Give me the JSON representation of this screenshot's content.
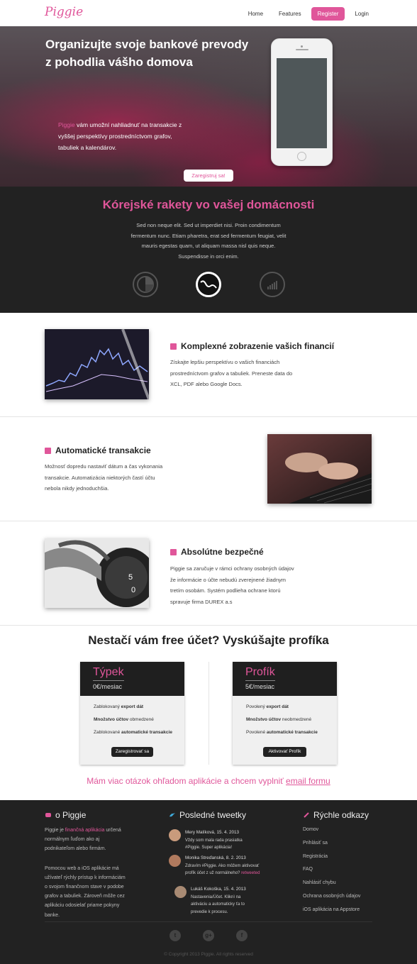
{
  "header": {
    "logo": "Piggie",
    "nav": [
      {
        "label": "Home"
      },
      {
        "label": "Features"
      },
      {
        "label": "Register"
      },
      {
        "label": "Login"
      }
    ]
  },
  "hero": {
    "title_line1": "Organizujte svoje bankové prevody",
    "title_line2": "z pohodlia vášho domova",
    "text_brand": "Piggie",
    "text_rest": " vám umožní nahliadnuť na transakcie z vyššej perspektívy prostredníctvom grafov, tabuliek a kalendárov.",
    "cta": "Zaregistruj sa!"
  },
  "promo": {
    "title": "Kórejské rakety vo vašej domácnosti",
    "text": "Sed non neque elit. Sed ut imperdiet nisi. Proin condimentum fermentum nunc. Etiam pharetra, erat sed fermentum feugiat, velit mauris egestas quam, ut aliquam massa nisl quis neque. Suspendisse in orci enim."
  },
  "features": [
    {
      "title": "Komplexné zobrazenie vašich financií",
      "text": "Získajte lepšiu perspektívu o vašich financiách prostredníctvom grafov a tabuliek. Preneste data do XCL, PDF alebo Google Docs."
    },
    {
      "title": "Automatické transakcie",
      "text": "Možnosť dopredu nastaviť dátum a čas vykonania transakcie. Automatizácia niektorých častí účtu nebola nikdy jednoduchšia."
    },
    {
      "title": "Absolútne bezpečné",
      "text": "Piggie sa zaručuje v rámci ochrany osobných údajov že informácie o účte nebudú zverejnené žiadnym tretím osobám. Systém podlieha ochrane ktorú spravuje firma DUREX a.s"
    }
  ],
  "pricing": {
    "title": "Nestačí vám free účet? Vyskúšajte profíka",
    "plans": [
      {
        "name": "Týpek",
        "price": "0€/mesiac",
        "rows": [
          {
            "pre": "Zablokovaný ",
            "strong": "export dát",
            "post": ""
          },
          {
            "pre": "",
            "strong": "Množstvo účtov",
            "post": " obmedzené"
          },
          {
            "pre": "Zablokované ",
            "strong": "automatické transakcie",
            "post": ""
          }
        ],
        "button": "Zaregistrovať sa"
      },
      {
        "name": "Profík",
        "price": "5€/mesiac",
        "rows": [
          {
            "pre": "Povolený ",
            "strong": "export dát",
            "post": ""
          },
          {
            "pre": "",
            "strong": "Množstvo účtov",
            "post": " neobmedzené"
          },
          {
            "pre": "Povolené ",
            "strong": "automatické transakcie",
            "post": ""
          }
        ],
        "button": "Aktivovať Profík"
      }
    ],
    "more_text": "Mám viac otázok ohľadom aplikácie a chcem vyplniť ",
    "more_link": "email formu"
  },
  "footer": {
    "about_title": "o Piggie",
    "about_p1_pre": "Piggie je ",
    "about_p1_link": "finančná aplikácia",
    "about_p1_post": " určená normálnym ľuďom ako aj podnikateľom alebo firmám.",
    "about_p2": "Pomocou web a iOS aplikácie má užívateľ rýchly prístup k informáciám o svojom finančnom stave v podobe grafov a tabuliek. Zároveň môže cez aplikáciu odosielať priame pokyny banke.",
    "tweets_title": "Posledné tweetky",
    "tweets": [
      {
        "name": "Mery Malíková, 15. 4. 2013",
        "text": "Vždy som mala rada prasiatka #Piggie. Super aplikácia!"
      },
      {
        "name": "Monika Streďanská, 8. 2. 2013",
        "text": "Zdravím #Piggie. Ako môžem aktivovať profík účet z už normálneho?",
        "extra": "retweeted"
      },
      {
        "name": "Lukáš Kokoška, 15. 4. 2013",
        "text": "Nastavenia/Účet. Kliknì na aktiváciu a automaticky ťa to prevedie k procesu."
      }
    ],
    "links_title": "Rýchle odkazy",
    "links": [
      "Domov",
      "Prihlásiť sa",
      "Registrácia",
      "FAQ",
      "Nahlásiť chybu",
      "Ochrana osobných údajov",
      "iOS aplikácia na Appstore"
    ],
    "social": [
      "t",
      "g+",
      "f"
    ],
    "copyright": "© Copyright 2013 Piggie. All rights reserved"
  },
  "colors": {
    "accent": "#e0569a",
    "dark": "#222222"
  }
}
